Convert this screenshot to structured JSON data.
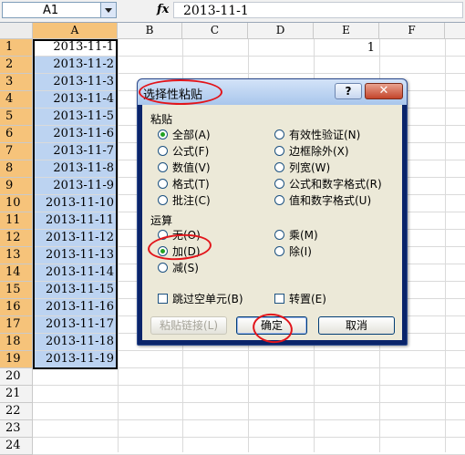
{
  "formula_bar": {
    "name_box": "A1",
    "fx_label": "fx",
    "formula": "2013-11-1"
  },
  "sheet": {
    "columns": [
      "A",
      "B",
      "C",
      "D",
      "E",
      "F"
    ],
    "rows": [
      "1",
      "2",
      "3",
      "4",
      "5",
      "6",
      "7",
      "8",
      "9",
      "10",
      "11",
      "12",
      "13",
      "14",
      "15",
      "16",
      "17",
      "18",
      "19",
      "20",
      "21",
      "22",
      "23",
      "24"
    ],
    "column_a_values": [
      "2013-11-1",
      "2013-11-2",
      "2013-11-3",
      "2013-11-4",
      "2013-11-5",
      "2013-11-6",
      "2013-11-7",
      "2013-11-8",
      "2013-11-9",
      "2013-11-10",
      "2013-11-11",
      "2013-11-12",
      "2013-11-13",
      "2013-11-14",
      "2013-11-15",
      "2013-11-16",
      "2013-11-17",
      "2013-11-18",
      "2013-11-19"
    ],
    "e1_value": "1"
  },
  "dialog": {
    "title": "选择性粘贴",
    "help_label": "?",
    "close_label": "✕",
    "paste_group_label": "粘贴",
    "paste_options": [
      {
        "label": "全部(A)",
        "checked": true
      },
      {
        "label": "公式(F)",
        "checked": false
      },
      {
        "label": "数值(V)",
        "checked": false
      },
      {
        "label": "格式(T)",
        "checked": false
      },
      {
        "label": "批注(C)",
        "checked": false
      },
      {
        "label": "有效性验证(N)",
        "checked": false
      },
      {
        "label": "边框除外(X)",
        "checked": false
      },
      {
        "label": "列宽(W)",
        "checked": false
      },
      {
        "label": "公式和数字格式(R)",
        "checked": false
      },
      {
        "label": "值和数字格式(U)",
        "checked": false
      }
    ],
    "operation_group_label": "运算",
    "operation_options": [
      {
        "label": "无(O)",
        "checked": false
      },
      {
        "label": "加(D)",
        "checked": true
      },
      {
        "label": "减(S)",
        "checked": false
      },
      {
        "label": "乘(M)",
        "checked": false
      },
      {
        "label": "除(I)",
        "checked": false
      }
    ],
    "skip_blanks_label": "跳过空单元(B)",
    "transpose_label": "转置(E)",
    "paste_link_label": "粘贴链接(L)",
    "ok_label": "确定",
    "cancel_label": "取消"
  },
  "colors": {
    "selected_header": "#f6c37a",
    "selection_fill": "#bcd3f1",
    "annotation_red": "#e2141a",
    "radio_dot": "#21a121"
  }
}
